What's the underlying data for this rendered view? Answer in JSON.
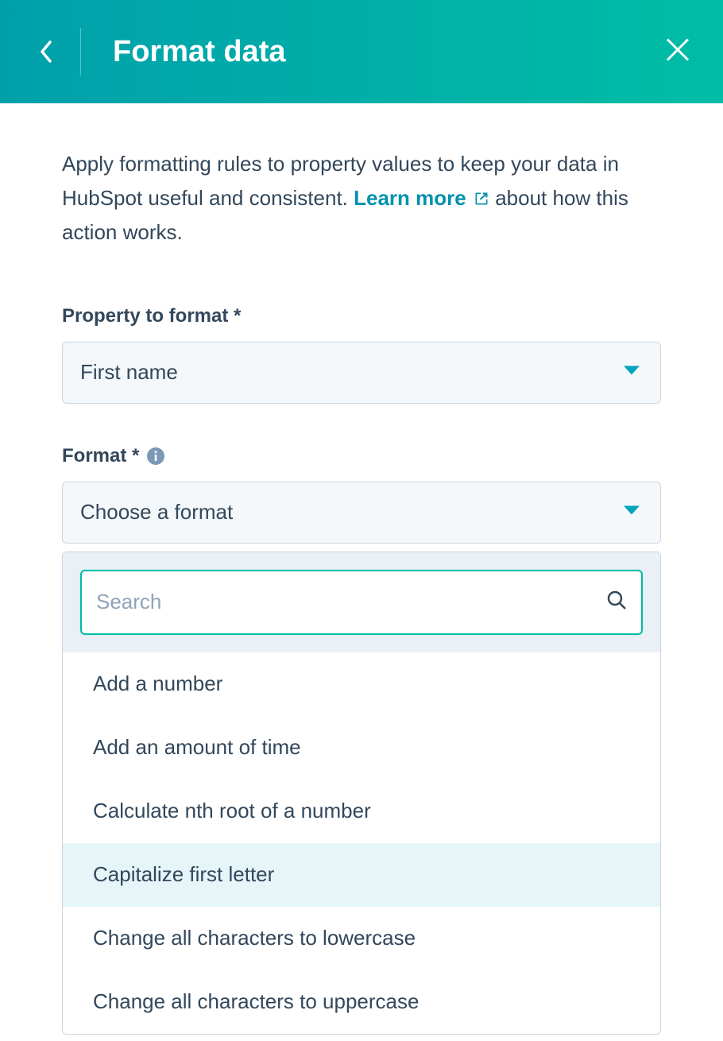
{
  "header": {
    "title": "Format data"
  },
  "intro": {
    "text1": "Apply formatting rules to property values to keep your data in HubSpot useful and consistent. ",
    "learn_label": "Learn more",
    "text2": " about how this action works."
  },
  "property": {
    "label": "Property to format *",
    "value": "First name"
  },
  "format": {
    "label": "Format *",
    "placeholder": "Choose a format",
    "search_placeholder": "Search",
    "options": [
      {
        "label": "Add a number",
        "highlight": false
      },
      {
        "label": "Add an amount of time",
        "highlight": false
      },
      {
        "label": "Calculate nth root of a number",
        "highlight": false
      },
      {
        "label": "Capitalize first letter",
        "highlight": true
      },
      {
        "label": "Change all characters to lowercase",
        "highlight": false
      },
      {
        "label": "Change all characters to uppercase",
        "highlight": false
      }
    ]
  }
}
